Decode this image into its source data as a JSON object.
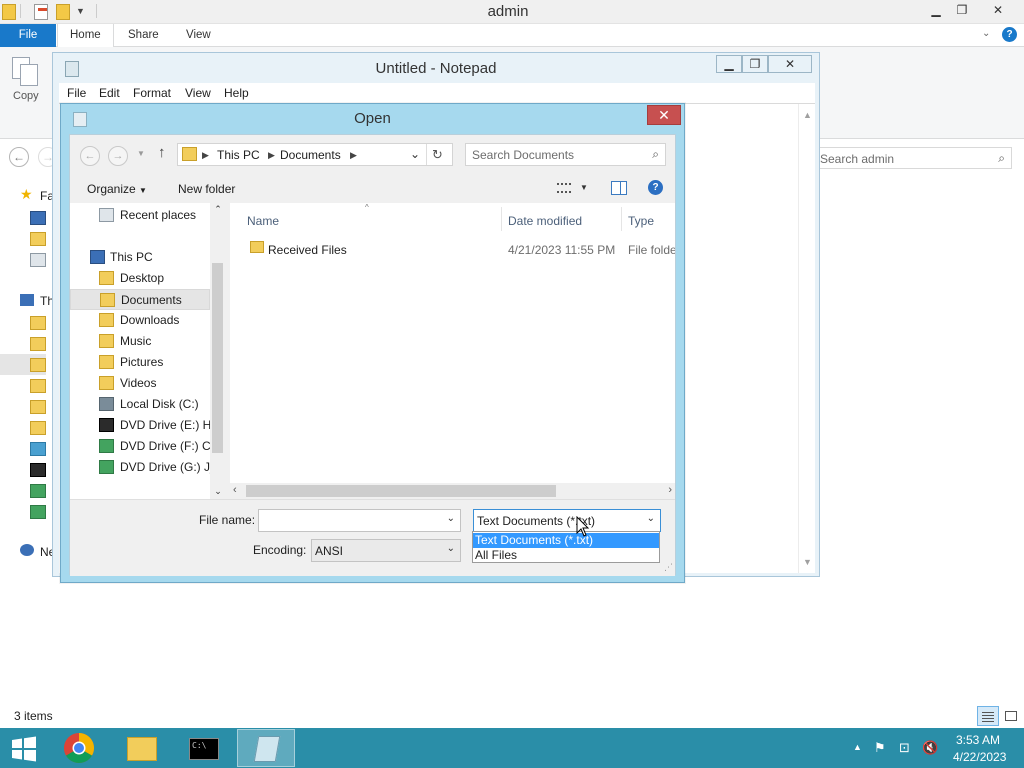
{
  "explorer": {
    "title": "admin",
    "ribbon_tabs": [
      "File",
      "Home",
      "Share",
      "View"
    ],
    "copy_label": "Copy",
    "search_placeholder": "Search admin",
    "sidebar_fragments": [
      "Fa",
      "Th",
      "Ne"
    ],
    "status": "3 items"
  },
  "notepad": {
    "title": "Untitled - Notepad",
    "menu": [
      "File",
      "Edit",
      "Format",
      "View",
      "Help"
    ]
  },
  "dialog": {
    "title": "Open",
    "close_glyph": "✕",
    "breadcrumb": [
      "This PC",
      "Documents"
    ],
    "search_placeholder": "Search Documents",
    "toolbar": {
      "organize": "Organize",
      "new_folder": "New folder"
    },
    "nav_items": [
      {
        "label": "Recent places",
        "icon": "recent-icon"
      },
      {
        "label": "This PC",
        "icon": "pc-icon"
      },
      {
        "label": "Desktop",
        "icon": "folder-icon"
      },
      {
        "label": "Documents",
        "icon": "folder-icon",
        "selected": true
      },
      {
        "label": "Downloads",
        "icon": "folder-icon"
      },
      {
        "label": "Music",
        "icon": "folder-icon"
      },
      {
        "label": "Pictures",
        "icon": "folder-icon"
      },
      {
        "label": "Videos",
        "icon": "folder-icon"
      },
      {
        "label": "Local Disk (C:)",
        "icon": "disk-icon"
      },
      {
        "label": "DVD Drive (E:) Hi",
        "icon": "dvd-icon"
      },
      {
        "label": "DVD Drive (F:) CC",
        "icon": "dvd-icon"
      },
      {
        "label": "DVD Drive (G:) J_(",
        "icon": "dvd-icon"
      }
    ],
    "columns": [
      "Name",
      "Date modified",
      "Type"
    ],
    "files": [
      {
        "name": "Received Files",
        "date": "4/21/2023 11:55 PM",
        "type": "File folder"
      }
    ],
    "file_name_label": "File name:",
    "file_name_value": "",
    "encoding_label": "Encoding:",
    "encoding_value": "ANSI",
    "filter_value": "Text Documents (*.txt)",
    "filter_options": [
      "Text Documents (*.txt)",
      "All Files"
    ]
  },
  "taskbar": {
    "time": "3:53 AM",
    "date": "4/22/2023"
  },
  "colors": {
    "dialog_frame": "#a6d9ee",
    "close_red": "#c75050",
    "taskbar": "#2a8ea8",
    "file_tab": "#1979ca",
    "highlight": "#3399ff"
  }
}
